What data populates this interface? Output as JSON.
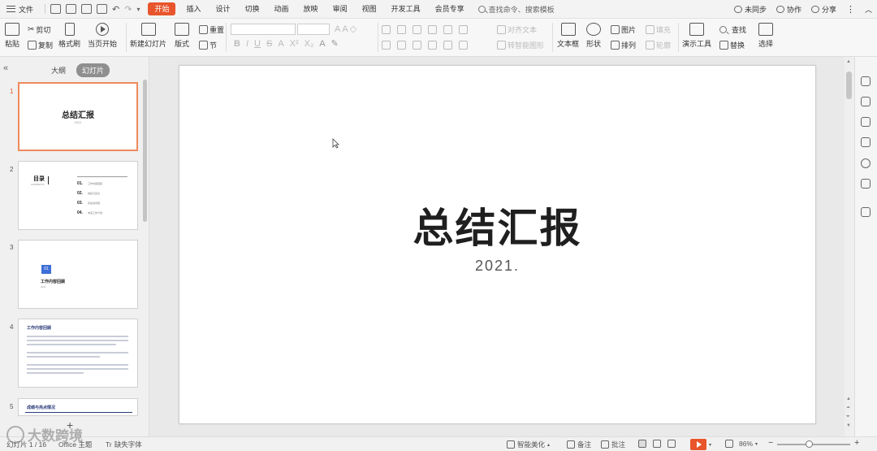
{
  "menubar": {
    "file_label": "文件",
    "tabs": [
      "开始",
      "插入",
      "设计",
      "切换",
      "动画",
      "放映",
      "审阅",
      "视图",
      "开发工具",
      "会员专享"
    ],
    "active_tab": "开始",
    "search_placeholder": "查找命令、搜索模板",
    "right": {
      "sync": "未同步",
      "collab": "协作",
      "share": "分享"
    }
  },
  "toolbar": {
    "paste": "粘贴",
    "cut": "剪切",
    "copy": "复制",
    "format_painter": "格式刷",
    "start_from_current": "当页开始",
    "new_slide": "新建幻灯片",
    "layout": "版式",
    "reset": "重置",
    "section": "节",
    "align_text": "对齐文本",
    "convert_smartart": "转智能图形",
    "textbox": "文本框",
    "shape": "形状",
    "picture": "图片",
    "arrange": "排列",
    "fill": "填充",
    "outline": "轮廓",
    "present_tools": "演示工具",
    "find": "查找",
    "replace": "替换",
    "select": "选择"
  },
  "left_panel": {
    "tab_outline": "大纲",
    "tab_slides": "幻灯片",
    "slides": [
      {
        "num": "1",
        "title": "总结汇报",
        "sub": "2021"
      },
      {
        "num": "2",
        "title": "目录",
        "en": "CONTENTS",
        "items": [
          {
            "n": "01.",
            "l": "工作内容回顾"
          },
          {
            "n": "02.",
            "l": "成绩与亮点"
          },
          {
            "n": "03.",
            "l": "存在的问题"
          },
          {
            "n": "04.",
            "l": "未来工作计划"
          }
        ]
      },
      {
        "num": "3",
        "badge": "01",
        "title": "工作内容回顾",
        "sub": "2021"
      },
      {
        "num": "4",
        "title": "工作内容回顾"
      },
      {
        "num": "5",
        "title": "成绩与亮点情况"
      }
    ]
  },
  "slide": {
    "title": "总结汇报",
    "subtitle": "2021."
  },
  "statusbar": {
    "slide_count": "幻灯片 1 / 16",
    "theme": "Office 主题",
    "missing_font": "缺失字体",
    "smart_beautify": "智能美化",
    "notes": "备注",
    "comments": "批注",
    "zoom": "86%",
    "zoom_fraction": 0.43
  },
  "watermark": {
    "text": "大数跨境"
  },
  "colors": {
    "accent": "#e8552c",
    "thumb_active_border": "#f08a5d",
    "badge_blue": "#3d6fd6"
  }
}
